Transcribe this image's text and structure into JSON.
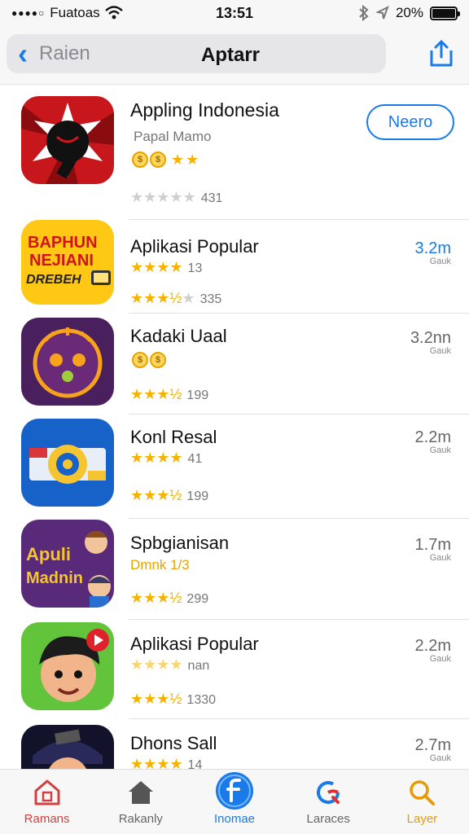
{
  "status_bar": {
    "carrier": "Fuatoas",
    "time": "13:51",
    "battery": "20%"
  },
  "navbar": {
    "back_label": "Raien",
    "title": "Aptarr"
  },
  "apps": [
    {
      "title": "Appling Indonesia",
      "subtitle": "Papal Mamo",
      "rating_count": "431",
      "rating": 0,
      "action_label": "Neero"
    },
    {
      "title": "Aplikasi Popular",
      "stars_line1": "13",
      "rating_count": "335",
      "size": "3.2m",
      "size_unit": "Gauk"
    },
    {
      "title": "Kadaki Uaal",
      "rating_count": "199",
      "size": "3.2nn",
      "size_unit": "Gauk"
    },
    {
      "title": "Konl Resal",
      "stars_line1": "41",
      "rating_count": "199",
      "size": "2.2m",
      "size_unit": "Gauk"
    },
    {
      "title": "Spbgianisan",
      "subtitle": "Dmnk 1/3",
      "rating_count": "299",
      "size": "1.7m",
      "size_unit": "Gauk"
    },
    {
      "title": "Aplikasi Popular",
      "stars_line1": "nan",
      "rating_count": "1330",
      "size": "2.2m",
      "size_unit": "Gauk"
    },
    {
      "title": "Dhons Sall",
      "stars_line1": "14",
      "size": "2.7m",
      "size_unit": "Gauk"
    }
  ],
  "icon_texts": {
    "app2_line1": "BAPHUN",
    "app2_line2": "NEJIANI",
    "app2_line3": "DREBEH",
    "app5_line1": "Apuli",
    "app5_line2": "Madnin"
  },
  "tabs": [
    {
      "label": "Ramans"
    },
    {
      "label": "Rakanly"
    },
    {
      "label": "Inomae"
    },
    {
      "label": "Laraces"
    },
    {
      "label": "Layer"
    }
  ],
  "colors": {
    "accent": "#1a7ae8",
    "star": "#f5b300",
    "tab_home": "#d04040",
    "tab_search": "#e89a00"
  }
}
